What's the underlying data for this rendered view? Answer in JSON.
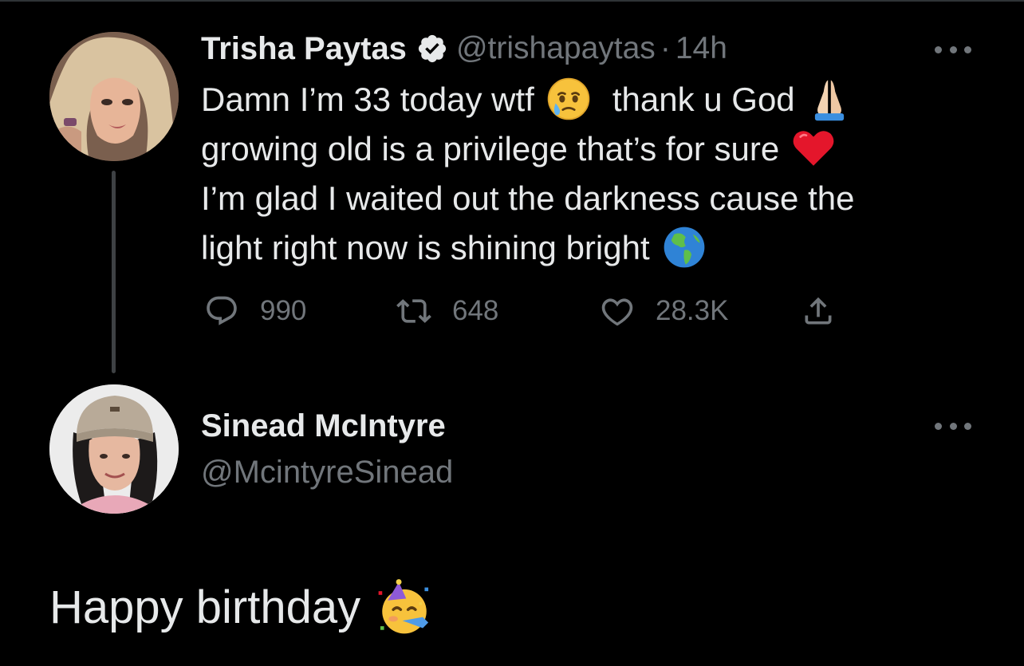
{
  "tweet": {
    "author_name": "Trisha Paytas",
    "author_handle": "@trishapaytas",
    "separator": "·",
    "time": "14h",
    "verified": true,
    "lines": [
      {
        "text": "Damn I’m 33 today wtf",
        "emoji": "face-holding-back-tears",
        "text2": "thank u God",
        "emoji2": "folded-hands"
      },
      {
        "text": "growing old is a privilege that’s for sure",
        "emoji": "red-heart"
      },
      {
        "text": "I’m glad I waited out the darkness cause the"
      },
      {
        "text": "light right now is shining bright",
        "emoji": "globe-americas"
      }
    ],
    "actions": {
      "reply_count": "990",
      "retweet_count": "648",
      "like_count": "28.3K"
    }
  },
  "reply": {
    "author_name": "Sinead McIntyre",
    "author_handle": "@McintyreSinead",
    "text": "Happy birthday",
    "emoji": "partying-face"
  },
  "colors": {
    "background": "#000000",
    "text_primary": "#e7e9ea",
    "text_secondary": "#71767b",
    "verified_badge": "#e7e9ea"
  }
}
